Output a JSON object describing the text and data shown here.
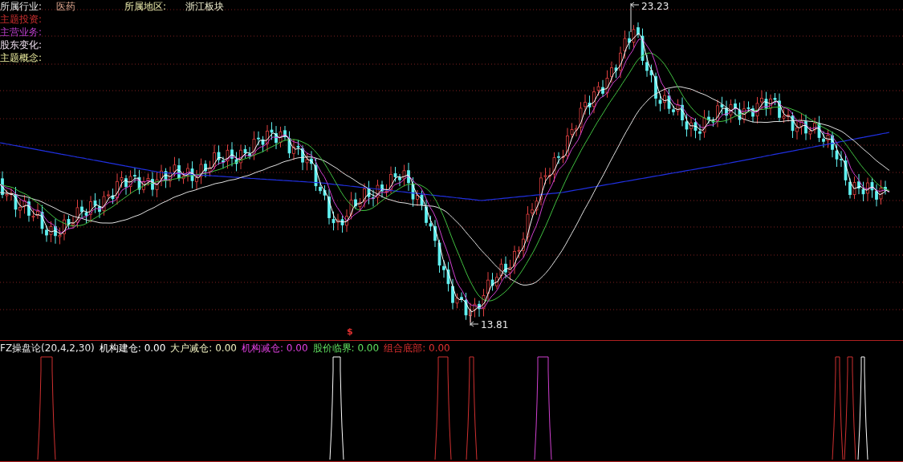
{
  "info_rows": [
    {
      "items": [
        {
          "label": "所属行业:",
          "value": "医药"
        },
        {
          "label": "所属地区:",
          "value": "浙江板块"
        }
      ]
    },
    {
      "items": [
        {
          "label": "主题投资:"
        }
      ]
    },
    {
      "items": [
        {
          "label": "主营业务:"
        }
      ]
    },
    {
      "items": [
        {
          "label": "股东变化:"
        }
      ]
    },
    {
      "items": [
        {
          "label": "主题概念:"
        }
      ]
    }
  ],
  "price_marks": [
    {
      "kind": "high",
      "text": "23.23"
    },
    {
      "kind": "low",
      "text": "13.81"
    }
  ],
  "signal_mark": "$",
  "indicator": {
    "title": "FZ操盘论(20,4,2,30)",
    "items": [
      {
        "label": "机构建仓:",
        "value": "0.00",
        "color": "#ffffff"
      },
      {
        "label": "大户减仓:",
        "value": "0.00",
        "color": "#f0f0c0"
      },
      {
        "label": "机构减仓:",
        "value": "0.00",
        "color": "#e040e0"
      },
      {
        "label": "股价临界:",
        "value": "0.00",
        "color": "#60e060"
      },
      {
        "label": "组合底部:",
        "value": "0.00",
        "color": "#e03030"
      }
    ]
  }
}
